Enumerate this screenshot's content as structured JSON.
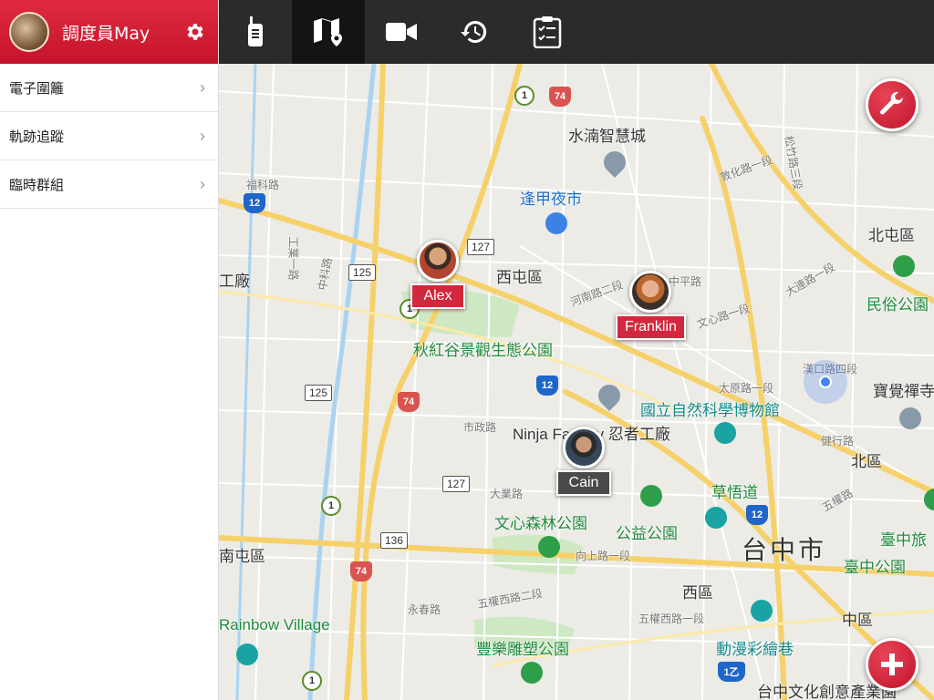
{
  "user": {
    "name": "調度員May"
  },
  "sidebar": {
    "items": [
      {
        "label": "電子圍籬"
      },
      {
        "label": "軌跡追蹤"
      },
      {
        "label": "臨時群組"
      }
    ]
  },
  "toolbar": {
    "tools": [
      "walkie-talkie",
      "map",
      "video",
      "history",
      "checklist"
    ],
    "active": "map"
  },
  "map": {
    "places": {
      "shuinan": "水湳智慧城",
      "fengjia": "逢甲夜市",
      "xitun": "西屯區",
      "beitun": "北屯區",
      "minsu": "民俗公園",
      "qiuhong": "秋紅谷景觀生態公園",
      "museum": "國立自然科學博物館",
      "ninja": "Ninja Factory 忍者工廠",
      "baojue": "寶覺禪寺",
      "north": "北區",
      "caowu": "草悟道",
      "wenxin": "文心森林公園",
      "gongyi": "公益公園",
      "taichung": "台中市",
      "taichung_park": "臺中公園",
      "taichung_tour": "臺中旅",
      "west": "西區",
      "central": "中區",
      "rainbow": "Rainbow Village",
      "fengle": "豐樂雕塑公園",
      "comic": "動漫彩繪巷",
      "culture": "台中文化創意產業園",
      "factory": "工廠",
      "nantun": "南屯區"
    },
    "streets": {
      "fuke": "福科路",
      "zhongke": "中科路",
      "gongye": "工業一路",
      "dunhua": "敦化路一段",
      "zhongping": "中平路",
      "henan": "河南路二段",
      "wenxin1": "文心路一段",
      "dalong": "大連路一段",
      "taiyuan": "太原路一段",
      "shizheng": "市政路",
      "jianxing": "健行路",
      "dayeh": "大業路",
      "xiangshang": "向上路一段",
      "wuquanxi": "五權西路二段",
      "wuquanxi1": "五權西路一段",
      "yongchun": "永春路",
      "wufu": "五權路",
      "hankou": "漢口路四段",
      "songzhu": "松竹路三段"
    },
    "routes": {
      "r127a": "127",
      "r125a": "125",
      "r125b": "125",
      "r127b": "127",
      "r136": "136",
      "r74a": "74",
      "r74b": "74",
      "r74c": "74",
      "r12a": "12",
      "r12b": "12",
      "r12c": "12",
      "r12d": "12",
      "r1a": "1",
      "r1b": "1",
      "r1c": "1",
      "r1d": "1",
      "r1e": "1乙"
    }
  },
  "markers": [
    {
      "name": "Alex"
    },
    {
      "name": "Franklin"
    },
    {
      "name": "Cain"
    }
  ]
}
